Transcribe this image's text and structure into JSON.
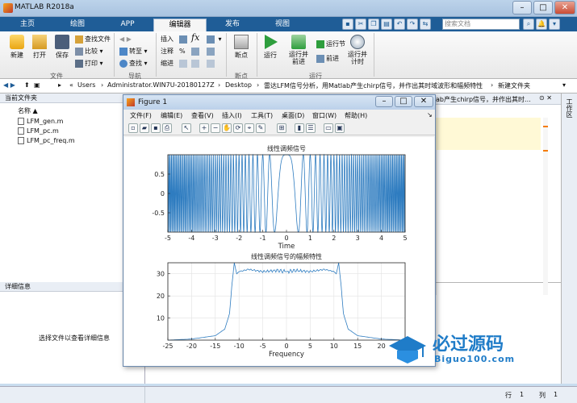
{
  "window": {
    "title": "MATLAB R2018a"
  },
  "tabs": [
    "主页",
    "绘图",
    "APP",
    "编辑器",
    "发布",
    "视图"
  ],
  "active_tab": "编辑器",
  "search": {
    "placeholder": "搜索文档"
  },
  "ribbon": {
    "new": "新建",
    "open": "打开",
    "save": "保存",
    "find_files": "查找文件",
    "compare": "比较",
    "print": "打印",
    "group_file": "文件",
    "insert": "插入",
    "fx": "fx",
    "goto": "转至",
    "find": "查找",
    "comment": "注释",
    "indent": "缩进",
    "group_nav": "导航",
    "breakpoints": "断点",
    "group_breakpoints": "断点",
    "run": "运行",
    "run_advance": "运行并前进",
    "run_section": "运行节",
    "advance": "前进",
    "run_and_time": "运行并计时",
    "group_run": "运行"
  },
  "address": {
    "items": [
      "Users",
      "Administrator.WIN7U-20180127Z",
      "Desktop",
      "雷达LFM信号分析，用Matlab产生chirp信号，并作出其时域波形和幅频特性",
      "新建文件夹"
    ]
  },
  "left_pane": {
    "header": "当前文件夹",
    "column": "名称",
    "files": [
      "LFM_gen.m",
      "LFM_pc.m",
      "LFM_pc_freq.m"
    ],
    "details_header": "详细信息",
    "details_text": "选择文件以查看详细信息"
  },
  "editor_tab_text": "ab产生chirp信号，并作出其时...",
  "workspace_tab": "工作区",
  "status": {
    "line_label": "行",
    "line": "1",
    "col_label": "列",
    "col": "1"
  },
  "figure": {
    "title": "Figure 1",
    "menus": [
      "文件(F)",
      "编辑(E)",
      "查看(V)",
      "插入(I)",
      "工具(T)",
      "桌面(D)",
      "窗口(W)",
      "帮助(H)"
    ]
  },
  "chart_data": [
    {
      "type": "line",
      "title": "线性调频信号",
      "xlabel": "Time",
      "ylabel": "",
      "xlim": [
        -5,
        5
      ],
      "ylim": [
        -1,
        1
      ],
      "xticks": [
        -5,
        -4,
        -3,
        -2,
        -1,
        0,
        1,
        2,
        3,
        4,
        5
      ],
      "yticks": [
        -0.5,
        0,
        0.5
      ],
      "series": [
        {
          "function": "cos(pi*K*t^2)",
          "K": 4,
          "t_range": [
            -5,
            5
          ]
        }
      ],
      "grid": false
    },
    {
      "type": "line",
      "title": "线性调频信号的幅频特性",
      "xlabel": "Frequency",
      "ylabel": "",
      "xlim": [
        -25,
        25
      ],
      "ylim": [
        0,
        35
      ],
      "xticks": [
        -25,
        -20,
        -15,
        -10,
        -5,
        0,
        5,
        10,
        15,
        20,
        25
      ],
      "yticks": [
        10,
        20,
        30
      ],
      "series": [
        {
          "x": [
            -25,
            -20,
            -15,
            -13,
            -12,
            -11.5,
            -11,
            -10.5,
            -10,
            -8,
            -5,
            -2,
            0,
            2,
            5,
            8,
            10,
            10.5,
            11,
            11.5,
            12,
            13,
            15,
            20,
            25
          ],
          "y": [
            0,
            0.5,
            2,
            5,
            12,
            25,
            35,
            30,
            31,
            32,
            31,
            31.5,
            31,
            31.5,
            31,
            32,
            31,
            30,
            35,
            25,
            12,
            5,
            2,
            0.5,
            0
          ]
        }
      ],
      "grid": true
    }
  ],
  "watermark": {
    "brand": "必过源码",
    "url": "Biguo100.com"
  }
}
